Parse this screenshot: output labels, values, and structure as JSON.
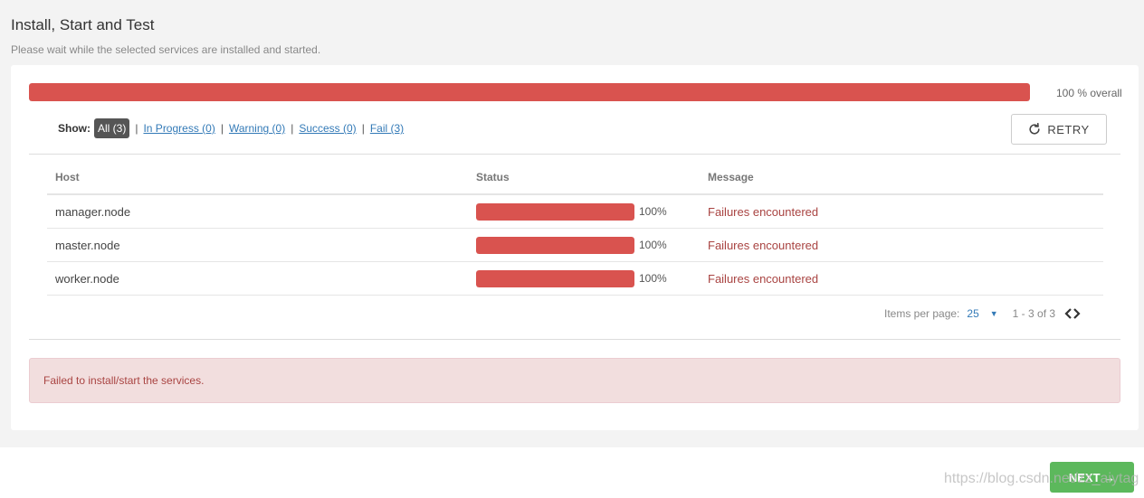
{
  "page": {
    "title": "Install, Start and Test",
    "subtitle": "Please wait while the selected services are installed and started."
  },
  "overall": {
    "progress_percent": 100,
    "label_value": "100",
    "label_suffix": " % overall",
    "bar_color": "#d9534f"
  },
  "filter": {
    "label": "Show:",
    "active": "All (3)",
    "separator": "|",
    "links": [
      "In Progress (0)",
      "Warning (0)",
      "Success (0)",
      "Fail (3)"
    ]
  },
  "retry": {
    "label": "RETRY",
    "icon": "refresh-icon"
  },
  "table": {
    "headers": {
      "host": "Host",
      "status": "Status",
      "message": "Message"
    },
    "rows": [
      {
        "host": "manager.node",
        "progress": 100,
        "progress_label": "100%",
        "message": "Failures encountered"
      },
      {
        "host": "master.node",
        "progress": 100,
        "progress_label": "100%",
        "message": "Failures encountered"
      },
      {
        "host": "worker.node",
        "progress": 100,
        "progress_label": "100%",
        "message": "Failures encountered"
      }
    ]
  },
  "pagination": {
    "items_per_page_label": "Items per page:",
    "items_per_page_value": "25",
    "range": "1 - 3 of 3",
    "caret_icon": "caret-down-icon",
    "prev_icon": "chevron-left-icon",
    "next_icon": "chevron-right-icon"
  },
  "alert": {
    "message": "Failed to install/start the services.",
    "color": "#a94442"
  },
  "footer": {
    "next_label": "NEXT →",
    "next_color": "#5cb85c"
  },
  "watermark": "https://blog.csdn.net/zz_aiytag"
}
